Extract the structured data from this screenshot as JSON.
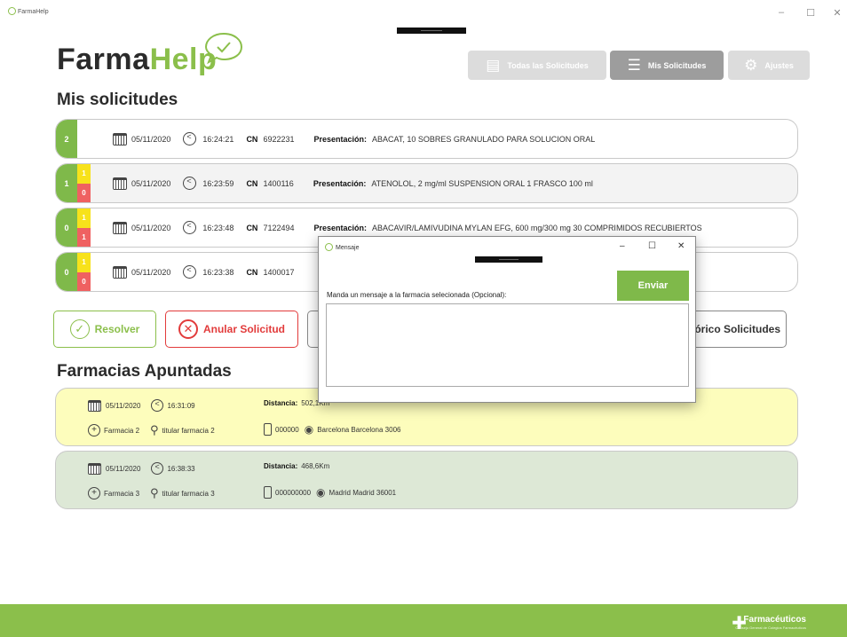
{
  "window": {
    "title": "FarmaHelp",
    "minimize": "–",
    "maximize": "☐",
    "close": "✕"
  },
  "logo": {
    "farma": "Farma",
    "help": "Help"
  },
  "nav": {
    "all_requests": "Todas las Solicitudes",
    "my_requests": "Mis Solicitudes",
    "settings": "Ajustes"
  },
  "sections": {
    "my_requests_title": "Mis solicitudes",
    "pharmacies_title": "Farmacias Apuntadas"
  },
  "requests": [
    {
      "count": "2",
      "yellow": "",
      "red": "",
      "date": "05/11/2020",
      "time": "16:24:21",
      "cn_label": "CN",
      "cn": "6922231",
      "pres_label": "Presentación:",
      "presentation": "ABACAT, 10 SOBRES GRANULADO PARA SOLUCION ORAL"
    },
    {
      "count": "1",
      "yellow": "1",
      "red": "0",
      "date": "05/11/2020",
      "time": "16:23:59",
      "cn_label": "CN",
      "cn": "1400116",
      "pres_label": "Presentación:",
      "presentation": "ATENOLOL, 2 mg/ml SUSPENSION ORAL 1 FRASCO 100 ml"
    },
    {
      "count": "0",
      "yellow": "1",
      "red": "1",
      "date": "05/11/2020",
      "time": "16:23:48",
      "cn_label": "CN",
      "cn": "7122494",
      "pres_label": "Presentación:",
      "presentation": "ABACAVIR/LAMIVUDINA MYLAN EFG, 600 mg/300 mg 30 COMPRIMIDOS RECUBIERTOS"
    },
    {
      "count": "0",
      "yellow": "1",
      "red": "0",
      "date": "05/11/2020",
      "time": "16:23:38",
      "cn_label": "CN",
      "cn": "1400017",
      "pres_label": "",
      "presentation": ""
    }
  ],
  "actions": {
    "resolve": "Resolver",
    "cancel": "Anular Solicitud",
    "history": "órico Solicitudes"
  },
  "pharmacies": [
    {
      "date": "05/11/2020",
      "time": "16:31:09",
      "dist_label": "Distancia:",
      "distance": "502,1Km",
      "name": "Farmacia 2",
      "owner": "titular farmacia 2",
      "phone": "000000",
      "address": "Barcelona Barcelona 3006",
      "color": "#fdfdbc"
    },
    {
      "date": "05/11/2020",
      "time": "16:38:33",
      "dist_label": "Distancia:",
      "distance": "468,6Km",
      "name": "Farmacia 3",
      "owner": "titular farmacia 3",
      "phone": "000000000",
      "address": "Madrid Madrid 36001",
      "color": "#dde8d6"
    }
  ],
  "dialog": {
    "title": "Mensaje",
    "message": "Manda un mensaje a la farmacia selecionada (Opcional):",
    "send": "Enviar",
    "text_value": ""
  },
  "footer": {
    "brand": "Farmacéuticos",
    "sub": "Consejo General de Colegios Farmacéuticos"
  },
  "colors": {
    "brand_green": "#8bbf4b",
    "alert_red": "#e23b3b",
    "warn_yellow": "#f7e21b"
  }
}
